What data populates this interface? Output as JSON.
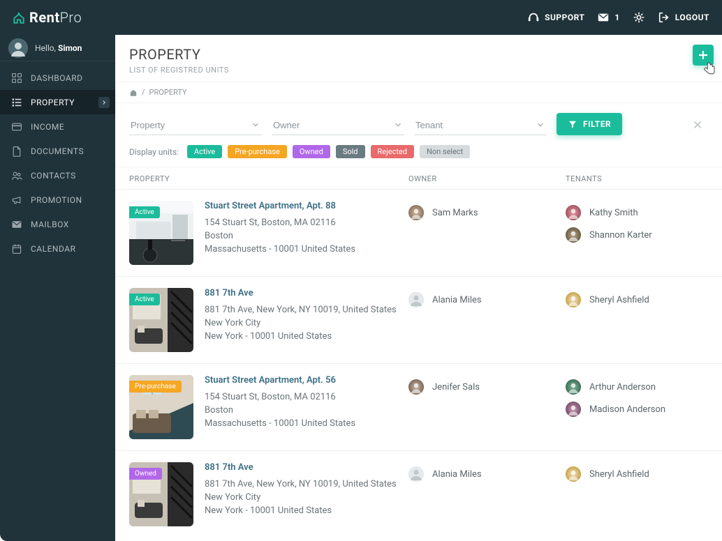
{
  "app": {
    "brand_a": "Rent",
    "brand_b": "Pro"
  },
  "top": {
    "support": "SUPPORT",
    "mail_count": "1",
    "logout": "LOGOUT"
  },
  "user": {
    "hello": "Hello,",
    "name": "Simon"
  },
  "nav": [
    {
      "label": "DASHBOARD",
      "icon": "grid"
    },
    {
      "label": "PROPERTY",
      "icon": "list",
      "active": true
    },
    {
      "label": "INCOME",
      "icon": "card"
    },
    {
      "label": "DOCUMENTS",
      "icon": "doc"
    },
    {
      "label": "CONTACTS",
      "icon": "people"
    },
    {
      "label": "PROMOTION",
      "icon": "mega"
    },
    {
      "label": "MAILBOX",
      "icon": "mail"
    },
    {
      "label": "CALENDAR",
      "icon": "cal"
    }
  ],
  "page": {
    "title": "PROPERTY",
    "subtitle": "LIST OF REGISTRED UNITS"
  },
  "crumbs": {
    "sep": "/",
    "current": "PROPERTY"
  },
  "filters": {
    "property": "Property",
    "owner": "Owner",
    "tenant": "Tenant",
    "button": "FILTER"
  },
  "chips": {
    "label": "Display units:",
    "items": [
      "Active",
      "Pre-purchase",
      "Owned",
      "Sold",
      "Rejected",
      "Non select"
    ]
  },
  "columns": {
    "property": "PROPERTY",
    "owner": "OWNER",
    "tenants": "TENANTS"
  },
  "rows": [
    {
      "status": "Active",
      "status_cls": "sb-active",
      "title": "Stuart Street Apartment, Apt. 88",
      "addr1": "154 Stuart St, Boston, MA 02116",
      "addr2": "Boston",
      "addr3": "Massachusetts - 10001 United States",
      "thumb": "kitchen",
      "owners": [
        {
          "name": "Sam Marks",
          "avatar": "a"
        }
      ],
      "tenants": [
        {
          "name": "Kathy Smith",
          "avatar": "b"
        },
        {
          "name": "Shannon Karter",
          "avatar": "c"
        }
      ]
    },
    {
      "status": "Active",
      "status_cls": "sb-active",
      "title": "881 7th Ave",
      "addr1": "881 7th Ave, New York, NY 10019, United States",
      "addr2": "New York City",
      "addr3": "New York - 10001 United States",
      "thumb": "loft",
      "owners": [
        {
          "name": "Alania Miles",
          "avatar": "blank"
        }
      ],
      "tenants": [
        {
          "name": "Sheryl Ashfield",
          "avatar": "d"
        }
      ]
    },
    {
      "status": "Pre-purchase",
      "status_cls": "sb-pre",
      "title": "Stuart Street Apartment, Apt. 56",
      "addr1": "154 Stuart St, Boston, MA 02116",
      "addr2": "Boston",
      "addr3": "Massachusetts - 10001 United States",
      "thumb": "attic",
      "owners": [
        {
          "name": "Jenifer Sals",
          "avatar": "e"
        }
      ],
      "tenants": [
        {
          "name": "Arthur Anderson",
          "avatar": "f"
        },
        {
          "name": "Madison Anderson",
          "avatar": "g"
        }
      ]
    },
    {
      "status": "Owned",
      "status_cls": "sb-owned",
      "title": "881 7th Ave",
      "addr1": "881 7th Ave, New York, NY 10019, United States",
      "addr2": "New York City",
      "addr3": "New York - 10001 United States",
      "thumb": "loft",
      "owners": [
        {
          "name": "Alania Miles",
          "avatar": "blank"
        }
      ],
      "tenants": [
        {
          "name": "Sheryl Ashfield",
          "avatar": "d"
        }
      ]
    }
  ]
}
